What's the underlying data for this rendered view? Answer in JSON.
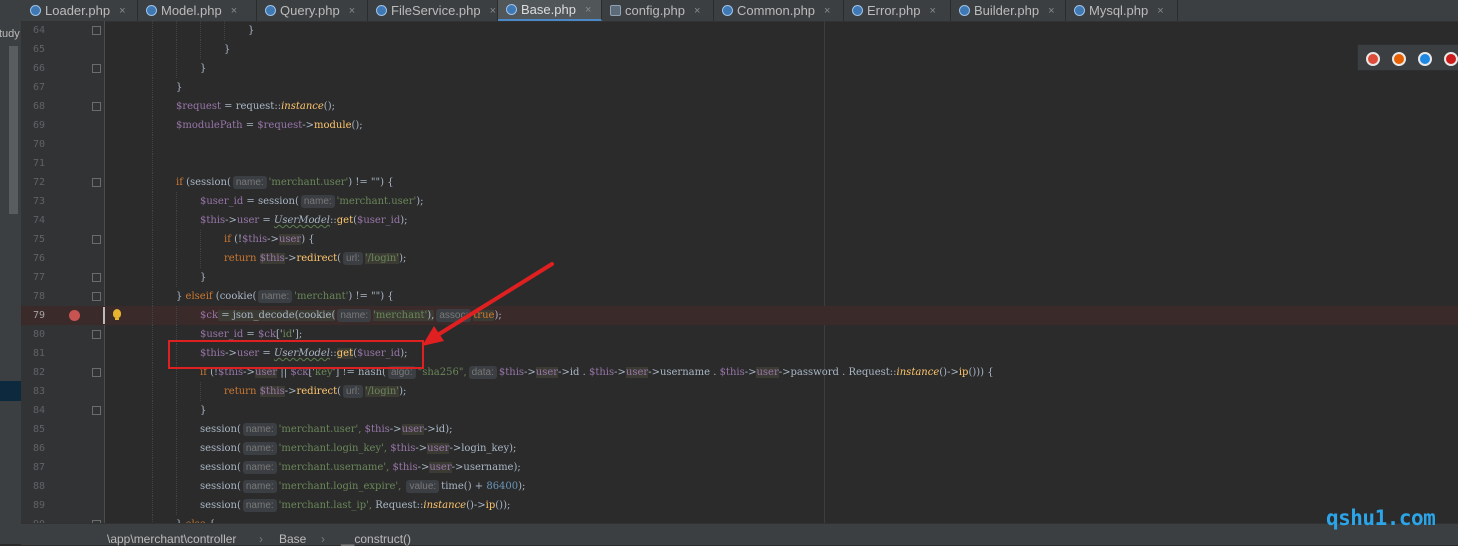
{
  "tabs": [
    {
      "label": "Loader.php",
      "active": false,
      "icon": "php-class-icon"
    },
    {
      "label": "Model.php",
      "active": false,
      "icon": "php-class-icon"
    },
    {
      "label": "Query.php",
      "active": false,
      "icon": "php-class-icon"
    },
    {
      "label": "FileService.php",
      "active": false,
      "icon": "php-class-icon"
    },
    {
      "label": "Base.php",
      "active": true,
      "icon": "php-class-icon"
    },
    {
      "label": "config.php",
      "active": false,
      "icon": "php-config-icon"
    },
    {
      "label": "Common.php",
      "active": false,
      "icon": "php-class-icon"
    },
    {
      "label": "Error.php",
      "active": false,
      "icon": "php-class-icon"
    },
    {
      "label": "Builder.php",
      "active": false,
      "icon": "php-class-icon"
    },
    {
      "label": "Mysql.php",
      "active": false,
      "icon": "php-class-icon"
    }
  ],
  "tab_close_glyph": "×",
  "left_strip_label": "tudy",
  "editor": {
    "current_line": 79,
    "breakpoint_line": 79,
    "lines": [
      [
        {
          "t": "}"
        }
      ],
      [
        {
          "t": "}"
        }
      ],
      [
        {
          "t": "}"
        }
      ],
      [
        {
          "t": "}"
        }
      ],
      [
        {
          "t": "$request",
          "c": "var"
        },
        {
          "t": " = request::"
        },
        {
          "t": "instance",
          "c": "sfn"
        },
        {
          "t": "();"
        }
      ],
      [
        {
          "t": "$modulePath",
          "c": "var"
        },
        {
          "t": " = "
        },
        {
          "t": "$request",
          "c": "var"
        },
        {
          "t": "->"
        },
        {
          "t": "module",
          "c": "fn"
        },
        {
          "t": "();"
        }
      ],
      [],
      [],
      [
        {
          "t": "if",
          "c": "kw"
        },
        {
          "t": " (session("
        },
        {
          "h": "name:"
        },
        {
          "t": "'merchant.user'",
          "c": "str"
        },
        {
          "t": ") != \"\") {"
        }
      ],
      [
        {
          "t": "$user_id",
          "c": "var"
        },
        {
          "t": " = session("
        },
        {
          "h": "name:"
        },
        {
          "t": "'merchant.user'",
          "c": "str"
        },
        {
          "t": ");"
        }
      ],
      [
        {
          "t": "$this",
          "c": "var"
        },
        {
          "t": "->"
        },
        {
          "t": "user",
          "c": "prop"
        },
        {
          "t": " = "
        },
        {
          "t": "UserModel",
          "c": "cls"
        },
        {
          "t": "::"
        },
        {
          "t": "get",
          "c": "fn"
        },
        {
          "t": "("
        },
        {
          "t": "$user_id",
          "c": "var"
        },
        {
          "t": ");"
        }
      ],
      [
        {
          "t": "if",
          "c": "kw"
        },
        {
          "t": " (!"
        },
        {
          "t": "$this",
          "c": "var"
        },
        {
          "t": "->"
        },
        {
          "t": "user",
          "c": "prop",
          "x": "hl"
        },
        {
          "t": ") {"
        }
      ],
      [
        {
          "t": "return ",
          "c": "kw"
        },
        {
          "t": "$this",
          "c": "var",
          "x": "hl"
        },
        {
          "t": "->"
        },
        {
          "t": "redirect",
          "c": "fn"
        },
        {
          "t": "("
        },
        {
          "h": "url:"
        },
        {
          "t": "'/login'",
          "c": "str",
          "x": "hl"
        },
        {
          "t": ");"
        }
      ],
      [
        {
          "t": "}"
        }
      ],
      [
        {
          "t": "} "
        },
        {
          "t": "elseif",
          "c": "kw"
        },
        {
          "t": " (cookie("
        },
        {
          "h": "name:"
        },
        {
          "t": "'merchant'",
          "c": "str"
        },
        {
          "t": ") != \"\") {"
        }
      ],
      [
        {
          "t": "$ck",
          "c": "var"
        },
        {
          "t": " = json_decode(cookie(",
          "x": "hl"
        },
        {
          "h": "name:"
        },
        {
          "t": "'merchant'",
          "c": "str",
          "x": "hl"
        },
        {
          "t": "),",
          "x": "hl"
        },
        {
          "h": "assoc:"
        },
        {
          "t": "true",
          "c": "kw",
          "x": "hl"
        },
        {
          "t": ");"
        }
      ],
      [
        {
          "t": "$user_id",
          "c": "var"
        },
        {
          "t": " = "
        },
        {
          "t": "$ck",
          "c": "var"
        },
        {
          "t": "['"
        },
        {
          "t": "id",
          "c": "str"
        },
        {
          "t": "'];"
        }
      ],
      [
        {
          "t": "$this",
          "c": "var"
        },
        {
          "t": "->"
        },
        {
          "t": "user",
          "c": "prop"
        },
        {
          "t": " = "
        },
        {
          "t": "UserModel",
          "c": "cls"
        },
        {
          "t": "::"
        },
        {
          "t": "get",
          "c": "fn",
          "x": "hl"
        },
        {
          "t": "("
        },
        {
          "t": "$user_id",
          "c": "var"
        },
        {
          "t": ");"
        }
      ],
      [
        {
          "t": "if",
          "c": "kw"
        },
        {
          "t": " (!"
        },
        {
          "t": "$this",
          "c": "var"
        },
        {
          "t": "->"
        },
        {
          "t": "user",
          "c": "prop",
          "x": "hl"
        },
        {
          "t": " || "
        },
        {
          "t": "$ck",
          "c": "var"
        },
        {
          "t": "['"
        },
        {
          "t": "key",
          "c": "str"
        },
        {
          "t": "'] != hash("
        },
        {
          "h": "algo:"
        },
        {
          "t": "\"sha256\",",
          "c": "str"
        },
        {
          "h": "data:"
        },
        {
          "t": "$this",
          "c": "var"
        },
        {
          "t": "->"
        },
        {
          "t": "user",
          "c": "prop",
          "x": "hl"
        },
        {
          "t": "->id . "
        },
        {
          "t": "$this",
          "c": "var"
        },
        {
          "t": "->"
        },
        {
          "t": "user",
          "c": "prop",
          "x": "hl"
        },
        {
          "t": "->username . "
        },
        {
          "t": "$this",
          "c": "var"
        },
        {
          "t": "->"
        },
        {
          "t": "user",
          "c": "prop",
          "x": "hl"
        },
        {
          "t": "->password . Request::"
        },
        {
          "t": "instance",
          "c": "sfn"
        },
        {
          "t": "()->"
        },
        {
          "t": "ip",
          "c": "fn"
        },
        {
          "t": "())) {"
        }
      ],
      [
        {
          "t": "return ",
          "c": "kw"
        },
        {
          "t": "$this",
          "c": "var",
          "x": "hl"
        },
        {
          "t": "->"
        },
        {
          "t": "redirect",
          "c": "fn"
        },
        {
          "t": "("
        },
        {
          "h": "url:"
        },
        {
          "t": "'/login'",
          "c": "str",
          "x": "hl"
        },
        {
          "t": ");"
        }
      ],
      [
        {
          "t": "}"
        }
      ],
      [
        {
          "t": "session("
        },
        {
          "h": "name:"
        },
        {
          "t": "'merchant.user',",
          "c": "str"
        },
        {
          "t": " "
        },
        {
          "t": "$this",
          "c": "var"
        },
        {
          "t": "->"
        },
        {
          "t": "user",
          "c": "prop",
          "x": "hl"
        },
        {
          "t": "->id);"
        }
      ],
      [
        {
          "t": "session("
        },
        {
          "h": "name:"
        },
        {
          "t": "'merchant.login_key',",
          "c": "str"
        },
        {
          "t": " "
        },
        {
          "t": "$this",
          "c": "var"
        },
        {
          "t": "->"
        },
        {
          "t": "user",
          "c": "prop",
          "x": "hl"
        },
        {
          "t": "->login_key);"
        }
      ],
      [
        {
          "t": "session("
        },
        {
          "h": "name:"
        },
        {
          "t": "'merchant.username',",
          "c": "str"
        },
        {
          "t": " "
        },
        {
          "t": "$this",
          "c": "var"
        },
        {
          "t": "->"
        },
        {
          "t": "user",
          "c": "prop",
          "x": "hl"
        },
        {
          "t": "->username);"
        }
      ],
      [
        {
          "t": "session("
        },
        {
          "h": "name:"
        },
        {
          "t": "'merchant.login_expire',",
          "c": "str"
        },
        {
          "t": " "
        },
        {
          "h": "value:"
        },
        {
          "t": "time() + "
        },
        {
          "t": "86400",
          "c": "num"
        },
        {
          "t": ");"
        }
      ],
      [
        {
          "t": "session("
        },
        {
          "h": "name:"
        },
        {
          "t": "'merchant.last_ip',",
          "c": "str"
        },
        {
          "t": " Request::"
        },
        {
          "t": "instance",
          "c": "sfn"
        },
        {
          "t": "()->"
        },
        {
          "t": "ip",
          "c": "fn"
        },
        {
          "t": "());"
        }
      ],
      [
        {
          "t": "} "
        },
        {
          "t": "else",
          "c": "kw"
        },
        {
          "t": " {"
        }
      ]
    ]
  },
  "breadcrumbs": [
    "\\app\\merchant\\controller",
    "Base",
    "__construct()"
  ],
  "breadcrumb_sep": "›",
  "browser_icons": [
    "chrome-icon",
    "firefox-icon",
    "safari-icon",
    "opera-icon"
  ],
  "browser_icon_colors": [
    "#dd4b39",
    "#e66000",
    "#1e88e5",
    "#cc1b1b"
  ],
  "annotation": {
    "color": "#e02020",
    "note": "red box around line 81 with arrow"
  },
  "watermark": "qshu1.com"
}
